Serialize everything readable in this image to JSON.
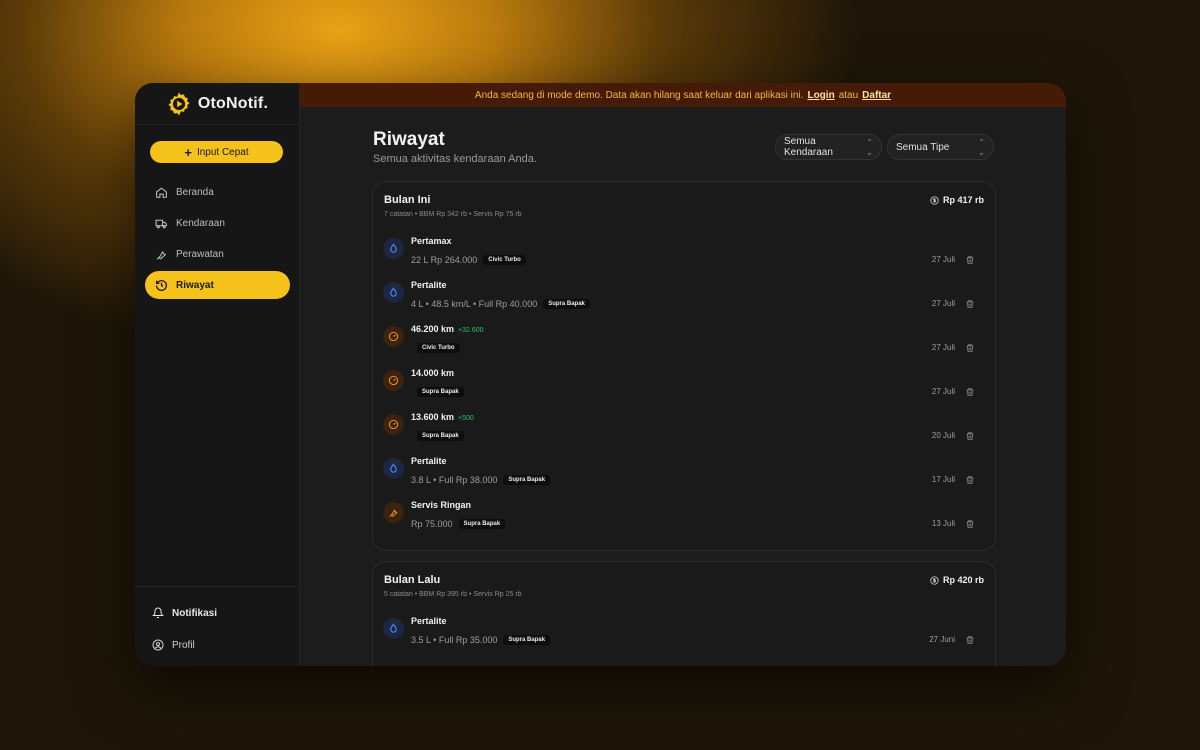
{
  "app": {
    "name": "OtoNotif."
  },
  "sidebar": {
    "quick_input": "Input Cepat",
    "items": [
      {
        "label": "Beranda",
        "icon": "home-icon"
      },
      {
        "label": "Kendaraan",
        "icon": "truck-icon"
      },
      {
        "label": "Perawatan",
        "icon": "wrench-icon"
      },
      {
        "label": "Riwayat",
        "icon": "history-icon",
        "active": true
      }
    ],
    "bottom": [
      {
        "label": "Notifikasi",
        "icon": "bell-icon"
      },
      {
        "label": "Profil",
        "icon": "user-circle-icon"
      }
    ]
  },
  "banner": {
    "text": "Anda sedang di mode demo. Data akan hilang saat keluar dari aplikasi ini.",
    "login": "Login",
    "or": "atau",
    "register": "Daftar"
  },
  "page": {
    "title": "Riwayat",
    "subtitle": "Semua aktivitas kendaraan Anda.",
    "filter_vehicle": "Semua Kendaraan",
    "filter_type": "Semua Tipe"
  },
  "groups": [
    {
      "title": "Bulan Ini",
      "meta": "7 catatan  • BBM Rp 342 rb  • Servis Rp 75 rb",
      "total": "Rp 417 rb",
      "entries": [
        {
          "type": "fuel",
          "title": "Pertamax",
          "delta": "",
          "detail": "22 L  Rp 264.000",
          "vehicle": "Civic Turbo",
          "date": "27 Juli"
        },
        {
          "type": "fuel",
          "title": "Pertalite",
          "delta": "",
          "detail": "4 L • 48.5 km/L • Full  Rp 40.000",
          "vehicle": "Supra Bapak",
          "date": "27 Juli"
        },
        {
          "type": "odo",
          "title": "46.200 km",
          "delta": "+32.600",
          "detail": "",
          "vehicle": "Civic Turbo",
          "date": "27 Juli"
        },
        {
          "type": "odo",
          "title": "14.000 km",
          "delta": "",
          "detail": "",
          "vehicle": "Supra Bapak",
          "date": "27 Juli"
        },
        {
          "type": "odo",
          "title": "13.600 km",
          "delta": "+500",
          "detail": "",
          "vehicle": "Supra Bapak",
          "date": "20 Juli"
        },
        {
          "type": "fuel",
          "title": "Pertalite",
          "delta": "",
          "detail": "3.8 L • Full  Rp 38.000",
          "vehicle": "Supra Bapak",
          "date": "17 Juli"
        },
        {
          "type": "svc",
          "title": "Servis Ringan",
          "delta": "",
          "detail": "Rp 75.000",
          "vehicle": "Supra Bapak",
          "date": "13 Juli"
        }
      ]
    },
    {
      "title": "Bulan Lalu",
      "meta": "5 catatan  • BBM Rp 395 rb  • Servis Rp 25 rb",
      "total": "Rp 420 rb",
      "entries": [
        {
          "type": "fuel",
          "title": "Pertalite",
          "delta": "",
          "detail": "3.5 L • Full  Rp 35.000",
          "vehicle": "Supra Bapak",
          "date": "27 Juni"
        }
      ]
    }
  ],
  "colors": {
    "accent": "#f5c21b",
    "banner_bg": "#451a06",
    "banner_text": "#f7b93c",
    "positive": "#32c06a",
    "fuel_icon": "#4f8cf7",
    "odo_icon": "#f08a1c"
  }
}
